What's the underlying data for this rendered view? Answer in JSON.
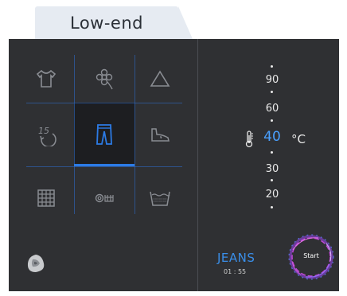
{
  "tab": {
    "label": "Low-end"
  },
  "programs": [
    {
      "icon": "shirt-icon"
    },
    {
      "icon": "flower-icon"
    },
    {
      "icon": "triangle-icon"
    },
    {
      "icon": "quick-15-icon"
    },
    {
      "icon": "jeans-icon",
      "selected": true
    },
    {
      "icon": "sneaker-icon"
    },
    {
      "icon": "grid-icon"
    },
    {
      "icon": "wool-icon"
    },
    {
      "icon": "basin-icon"
    }
  ],
  "temperatures": [
    "90",
    "60",
    "40",
    "30",
    "20"
  ],
  "selected_temperature": "40",
  "temperature_unit": "°C",
  "program": {
    "name": "JEANS",
    "time": "01 : 55"
  },
  "start": {
    "label": "Start"
  },
  "colors": {
    "accent": "#2c7be5",
    "panel": "#2f3033",
    "tab": "#e6ebf2"
  }
}
